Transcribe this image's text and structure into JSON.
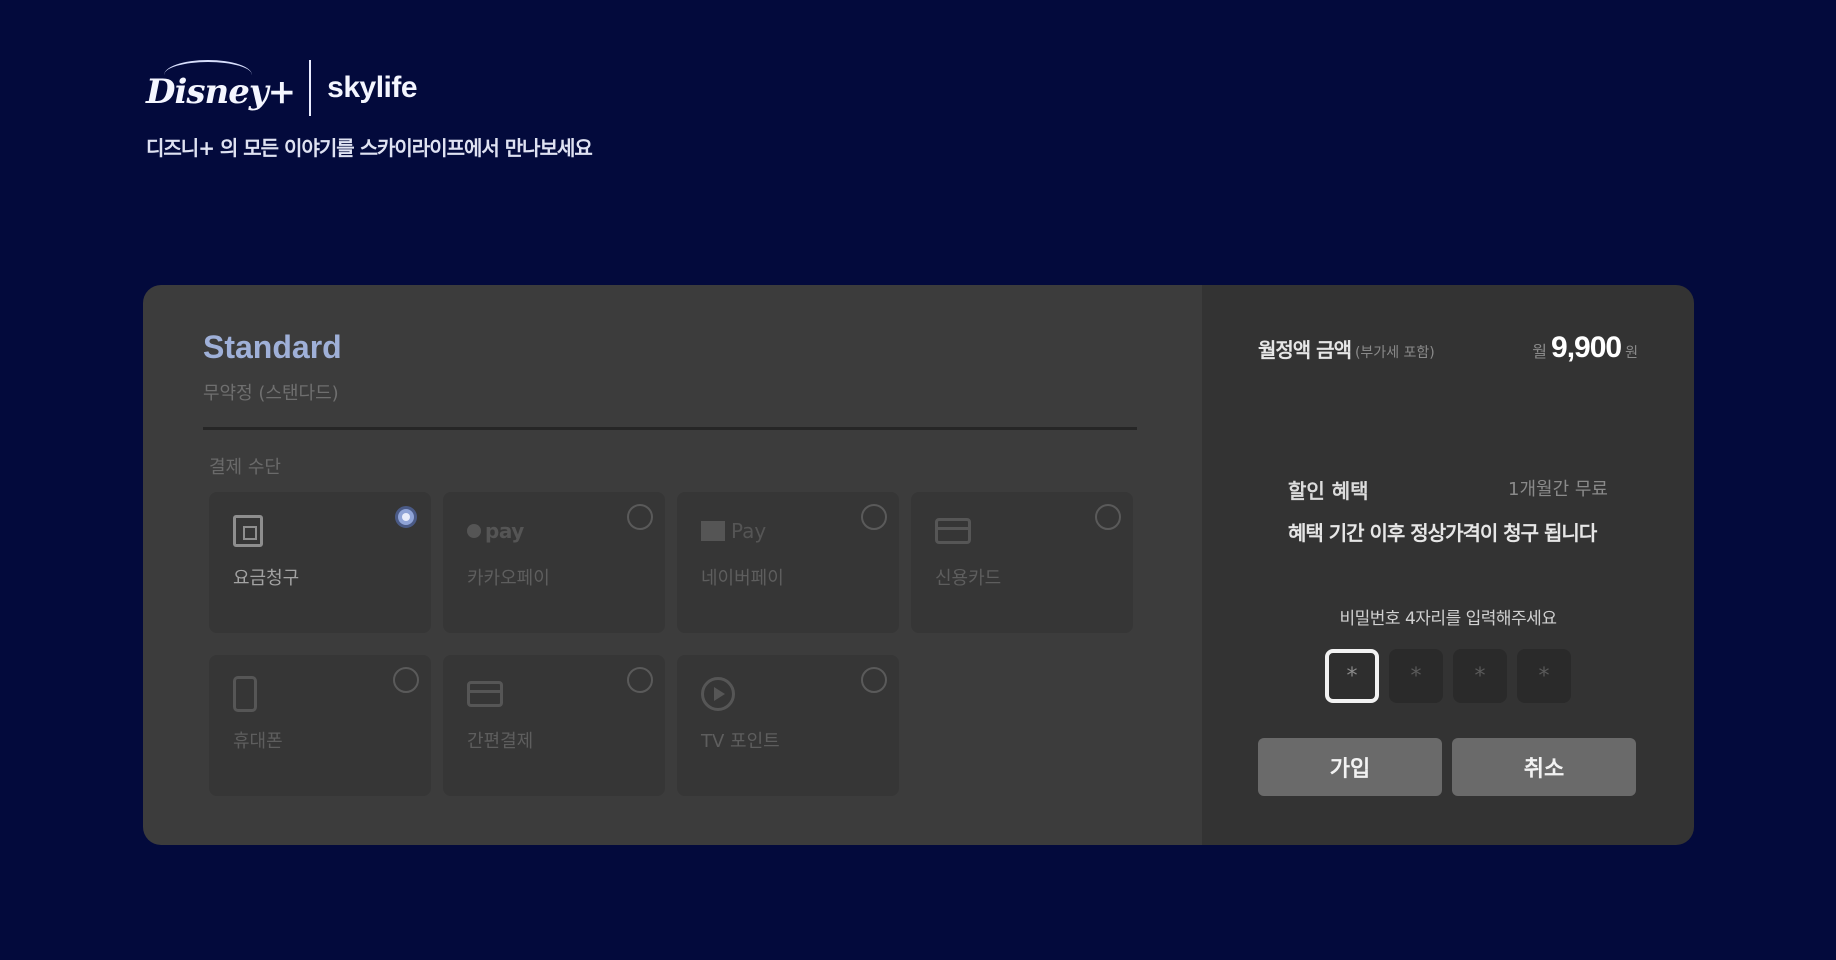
{
  "brand": {
    "disney_logo": "Disney+",
    "skylife_logo": "skylife",
    "tagline": "디즈니+ 의 모든 이야기를 스카이라이프에서 만나보세요"
  },
  "plan": {
    "name": "Standard",
    "subtitle": "무약정 (스탠다드)",
    "payment_method_label": "결제 수단"
  },
  "payment_methods": [
    {
      "label": "요금청구",
      "icon": "bill-icon",
      "selected": true
    },
    {
      "label": "카카오페이",
      "icon_text": "pay",
      "icon": "kakaopay-icon",
      "selected": false
    },
    {
      "label": "네이버페이",
      "icon_text": "Pay",
      "icon": "naverpay-icon",
      "selected": false
    },
    {
      "label": "신용카드",
      "icon": "credit-card-icon",
      "selected": false
    },
    {
      "label": "휴대폰",
      "icon": "phone-icon",
      "selected": false
    },
    {
      "label": "간편결제",
      "icon": "card-icon",
      "selected": false
    },
    {
      "label": "TV 포인트",
      "icon": "tv-point-icon",
      "selected": false
    }
  ],
  "summary": {
    "price_label": "월정액 금액",
    "price_note": "(부가세 포함)",
    "price_prefix": "월",
    "price_value": "9,900",
    "price_unit": "원",
    "discount_label": "할인 혜택",
    "discount_value": "1개월간 무료",
    "discount_note": "혜택 기간 이후 정상가격이 청구 됩니다",
    "pin_label": "비밀번호 4자리를 입력해주세요",
    "pin_placeholder": "*"
  },
  "buttons": {
    "join": "가입",
    "cancel": "취소"
  },
  "colors": {
    "background": "#030a3c",
    "panel_left": "#3c3c3c",
    "panel_right": "#333333",
    "accent": "#9fb0d8"
  }
}
